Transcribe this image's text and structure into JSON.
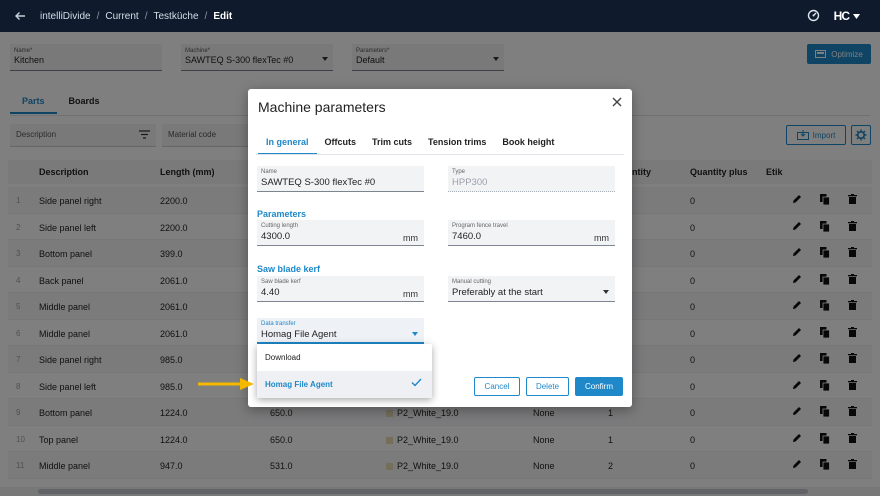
{
  "header": {
    "breadcrumb": [
      "intelliDivide",
      "Current",
      "Testküche",
      "Edit"
    ],
    "logo_text": "HC"
  },
  "form": {
    "name": {
      "label": "Name*",
      "value": "Kitchen"
    },
    "machine": {
      "label": "Machine*",
      "value": "SAWTEQ S-300 flexTec #0"
    },
    "parameters": {
      "label": "Parameters*",
      "value": "Default"
    },
    "optimize_label": "Optimize"
  },
  "tabs": [
    "Parts",
    "Boards"
  ],
  "filters": {
    "description_placeholder": "Description",
    "material_placeholder": "Material code"
  },
  "import_label": "Import",
  "table": {
    "headers": {
      "description": "Description",
      "length": "Length (mm)",
      "quantity": "ntity",
      "quantity_plus": "Quantity plus",
      "etik": "Etik"
    },
    "rows": [
      {
        "n": "1",
        "desc": "Side panel right",
        "len": "2200.0",
        "width": "",
        "material": "",
        "grain": "",
        "qty": "",
        "qplus": "0"
      },
      {
        "n": "2",
        "desc": "Side panel left",
        "len": "2200.0",
        "width": "",
        "material": "",
        "grain": "",
        "qty": "",
        "qplus": "0"
      },
      {
        "n": "3",
        "desc": "Bottom panel",
        "len": "399.0",
        "width": "",
        "material": "",
        "grain": "",
        "qty": "",
        "qplus": "0"
      },
      {
        "n": "4",
        "desc": "Back panel",
        "len": "2061.0",
        "width": "",
        "material": "",
        "grain": "",
        "qty": "",
        "qplus": "0"
      },
      {
        "n": "5",
        "desc": "Middle panel",
        "len": "2061.0",
        "width": "",
        "material": "",
        "grain": "",
        "qty": "",
        "qplus": "0"
      },
      {
        "n": "6",
        "desc": "Middle panel",
        "len": "2061.0",
        "width": "",
        "material": "",
        "grain": "",
        "qty": "",
        "qplus": "0"
      },
      {
        "n": "7",
        "desc": "Side panel right",
        "len": "985.0",
        "width": "",
        "material": "",
        "grain": "",
        "qty": "",
        "qplus": "0"
      },
      {
        "n": "8",
        "desc": "Side panel left",
        "len": "985.0",
        "width": "",
        "material": "",
        "grain": "",
        "qty": "",
        "qplus": "0"
      },
      {
        "n": "9",
        "desc": "Bottom panel",
        "len": "1224.0",
        "width": "650.0",
        "material": "P2_White_19.0",
        "grain": "None",
        "qty": "1",
        "qplus": "0"
      },
      {
        "n": "10",
        "desc": "Top panel",
        "len": "1224.0",
        "width": "650.0",
        "material": "P2_White_19.0",
        "grain": "None",
        "qty": "1",
        "qplus": "0"
      },
      {
        "n": "11",
        "desc": "Middle panel",
        "len": "947.0",
        "width": "531.0",
        "material": "P2_White_19.0",
        "grain": "None",
        "qty": "2",
        "qplus": "0"
      }
    ]
  },
  "modal": {
    "title": "Machine parameters",
    "tabs": [
      "In general",
      "Offcuts",
      "Trim cuts",
      "Tension trims",
      "Book height"
    ],
    "name": {
      "label": "Name",
      "value": "SAWTEQ S-300 flexTec #0"
    },
    "type": {
      "label": "Type",
      "value": "HPP300"
    },
    "parameters_heading": "Parameters",
    "cutting_length": {
      "label": "Cutting length",
      "value": "4300.0",
      "unit": "mm"
    },
    "fence_travel": {
      "label": "Program fence travel",
      "value": "7460.0",
      "unit": "mm"
    },
    "kerf_heading": "Saw blade kerf",
    "kerf": {
      "label": "Saw blade kerf",
      "value": "4.40",
      "unit": "mm"
    },
    "manual_cutting": {
      "label": "Manual cutting",
      "value": "Preferably at the start"
    },
    "data_transfer": {
      "label": "Data transfer",
      "value": "Homag File Agent"
    },
    "dropdown_options": [
      "Download",
      "Homag File Agent"
    ],
    "cancel_label": "Cancel",
    "delete_label": "Delete",
    "confirm_label": "Confirm"
  },
  "colors": {
    "accent": "#1e88c8",
    "topbar": "#0f1b2d",
    "arrow": "#f5b800"
  }
}
